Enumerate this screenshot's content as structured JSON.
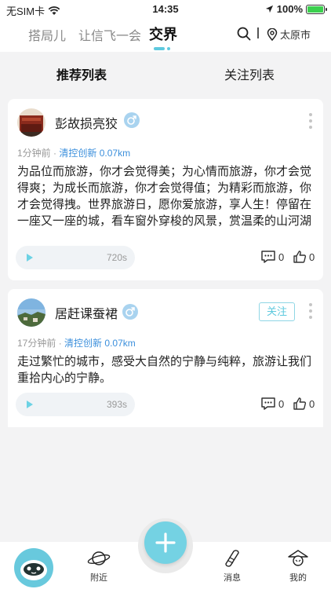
{
  "status_bar": {
    "carrier": "无SIM卡",
    "time": "14:35",
    "battery": "100%",
    "battery_level": 1.0
  },
  "top_nav": {
    "tabs": [
      "搭局儿",
      "让信飞一会",
      "交界"
    ],
    "active_tab": "交界",
    "location": "太原市"
  },
  "sub_tabs": {
    "items": [
      "推荐列表",
      "关注列表"
    ],
    "active": "推荐列表"
  },
  "posts": [
    {
      "username": "彭故损亮狡",
      "time_ago": "1分钟前",
      "dot": "·",
      "tag": "清控创新",
      "distance": "0.07km",
      "content": "为品位而旅游，你才会觉得美；为心情而旅游，你才会觉得爽；为成长而旅游，你才会觉得值；为精彩而旅游，你才会觉得拽。世界旅游日，愿你爱旅游，享人生！停留在一座又一座的城，看车窗外穿梭的风景，赏温柔的山河湖",
      "audio_duration": "720s",
      "comments": "0",
      "likes": "0",
      "follow_label": ""
    },
    {
      "username": "居赶课蚕裙",
      "time_ago": "17分钟前",
      "dot": "·",
      "tag": "清控创新",
      "distance": "0.07km",
      "content": "走过繁忙的城市，感受大自然的宁静与纯粹，旅游让我们重拾内心的宁静。",
      "audio_duration": "393s",
      "comments": "0",
      "likes": "0",
      "follow_label": "关注"
    }
  ],
  "bottom_nav": {
    "items": [
      "附近",
      "消息",
      "我的"
    ]
  },
  "colors": {
    "accent": "#5ec9de",
    "tag_blue": "#3b8fdc",
    "background": "#f3f3f4"
  }
}
